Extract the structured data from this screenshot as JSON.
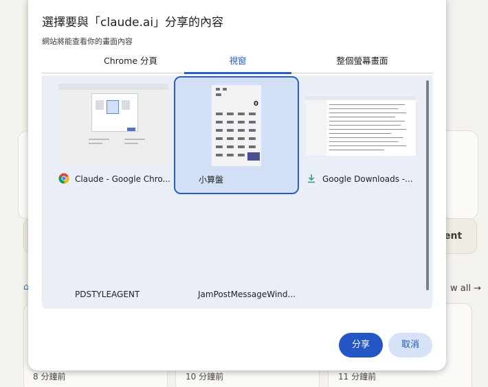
{
  "background_page": {
    "button_fragment": "ent",
    "view_all": "w all →",
    "recent_times": [
      "8 分鐘前",
      "10 分鐘前",
      "11 分鐘前"
    ]
  },
  "dialog": {
    "title": "選擇要與「claude.ai」分享的內容",
    "subtitle": "網站將能查看你的畫面內容",
    "tabs": [
      {
        "label": "Chrome 分頁",
        "active": false
      },
      {
        "label": "視窗",
        "active": true
      },
      {
        "label": "整個螢幕畫面",
        "active": false
      }
    ],
    "windows": [
      {
        "label": "Claude - Google Chro...",
        "icon": "chrome-icon",
        "selected": false
      },
      {
        "label": "小算盤",
        "icon": "none",
        "selected": true
      },
      {
        "label": "Google Downloads -...",
        "icon": "download-icon",
        "selected": false
      },
      {
        "label": "PDSTYLEAGENT",
        "icon": "none",
        "selected": false
      },
      {
        "label": "JamPostMessageWind...",
        "icon": "none",
        "selected": false
      }
    ],
    "calculator_display": "0",
    "buttons": {
      "share": "分享",
      "cancel": "取消"
    },
    "colors": {
      "accent": "#2a5bc7",
      "selected_bg": "#d2e0f7",
      "grid_bg": "#e9eef7"
    }
  }
}
